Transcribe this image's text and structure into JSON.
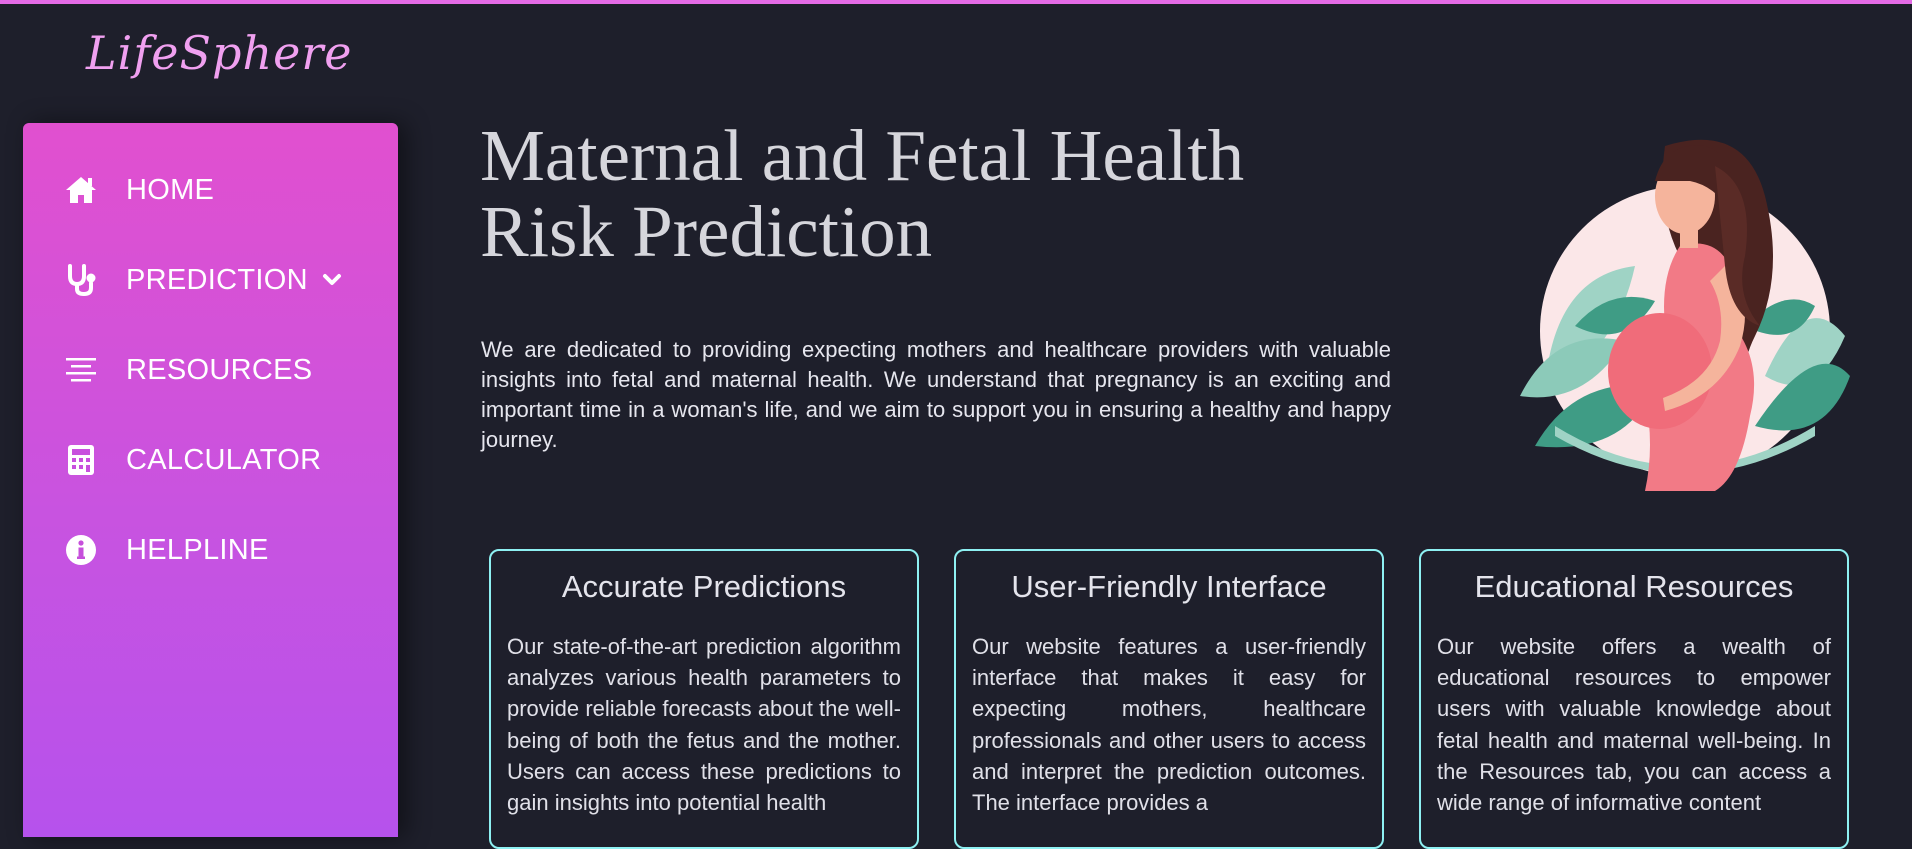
{
  "brand": {
    "logo_text": "LifeSphere"
  },
  "colors": {
    "accent_pink": "#e46be6",
    "sidebar_top": "#e150cf",
    "sidebar_bottom": "#b652ec",
    "card_border": "#8ef0f2",
    "background": "#1e1f2b"
  },
  "sidebar": {
    "items": [
      {
        "label": "HOME",
        "icon": "home-icon"
      },
      {
        "label": "PREDICTION",
        "icon": "stethoscope-icon",
        "has_dropdown": true
      },
      {
        "label": "RESOURCES",
        "icon": "align-center-icon"
      },
      {
        "label": "CALCULATOR",
        "icon": "calculator-icon"
      },
      {
        "label": "HELPLINE",
        "icon": "info-circle-icon"
      }
    ]
  },
  "hero": {
    "title_line1": "Maternal and Fetal Health",
    "title_line2": "Risk Prediction",
    "intro": "We are dedicated to providing expecting mothers and healthcare providers with valuable insights into fetal and maternal health. We understand that pregnancy is an exciting and important time in a woman's life, and we aim to support you in ensuring a healthy and happy journey."
  },
  "cards": [
    {
      "title": "Accurate Predictions",
      "text": "Our state-of-the-art prediction algorithm analyzes various health parameters to provide reliable forecasts about the well-being of both the fetus and the mother. Users can access these predictions to gain insights into potential health"
    },
    {
      "title": "User-Friendly Interface",
      "text": "Our website features a user-friendly interface that makes it easy for expecting mothers, healthcare professionals and other users to access and interpret the prediction outcomes. The interface provides a"
    },
    {
      "title": "Educational Resources",
      "text": "Our website offers a wealth of educational resources to empower users with valuable knowledge about fetal health and maternal well-being. In the Resources tab, you can access a wide range of informative content"
    }
  ]
}
